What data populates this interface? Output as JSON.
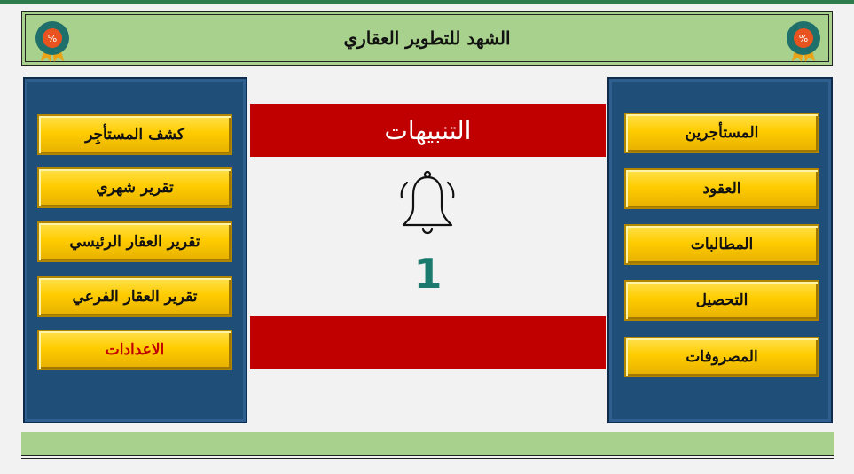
{
  "header": {
    "title": "الشهد للتطوير العقاري"
  },
  "icons": {
    "badge": "percent-medal-icon",
    "bell": "bell-icon"
  },
  "colors": {
    "header_bg": "#a9d18e",
    "panel_bg": "#1f4e79",
    "button_bg": "#ffcc00",
    "alert_bar": "#c00000",
    "count_color": "#1a7a6e"
  },
  "left_menu": {
    "items": [
      {
        "label": "كشف المستأجِر"
      },
      {
        "label": "تقرير شهري"
      },
      {
        "label": "تقرير العقار الرئيسي"
      },
      {
        "label": "تقرير العقار الفرعي"
      },
      {
        "label": "الاعدادات"
      }
    ]
  },
  "right_menu": {
    "items": [
      {
        "label": "المستأجرين"
      },
      {
        "label": "العقود"
      },
      {
        "label": "المطالبات"
      },
      {
        "label": "التحصيل"
      },
      {
        "label": "المصروفات"
      }
    ]
  },
  "alerts": {
    "title": "التنبيهات",
    "count": "1"
  }
}
